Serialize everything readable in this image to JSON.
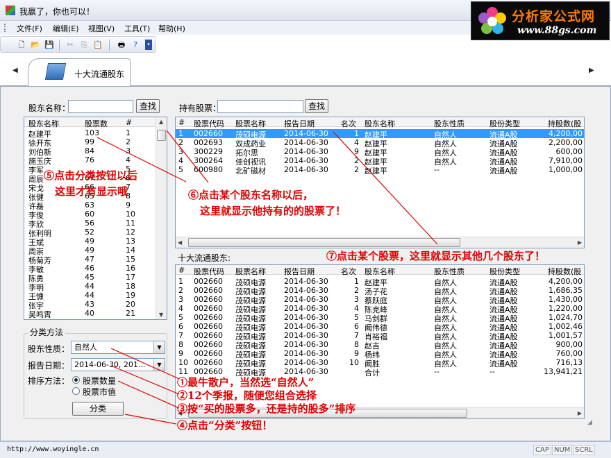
{
  "window": {
    "title": "我嬴了，你也可以！"
  },
  "logo": {
    "title": "分析家公式网",
    "url": "www.88gs.com"
  },
  "menu": [
    "文件(F)",
    "编辑(E)",
    "视图(V)",
    "工具(T)",
    "帮助(H)"
  ],
  "toolbar": {
    "icons": [
      "new-icon",
      "open-icon",
      "save-icon",
      "cut-icon",
      "copy-icon",
      "paste-icon",
      "print-icon",
      "help-icon"
    ]
  },
  "tab": {
    "label": "十大流通股东"
  },
  "left": {
    "name_label": "股东名称：",
    "search_btn": "查找",
    "columns": [
      "股东名称",
      "股票数",
      "#"
    ],
    "rows": [
      [
        "赵建平",
        "103",
        "1"
      ],
      [
        "徐开东",
        "99",
        "2"
      ],
      [
        "刘伯新",
        "84",
        "3"
      ],
      [
        "施玉庆",
        "76",
        "4"
      ],
      [
        "李军",
        "",
        "5"
      ],
      [
        "周辰",
        "67",
        "6"
      ],
      [
        "宋戈",
        "66",
        "7"
      ],
      [
        "张健",
        "65",
        "8"
      ],
      [
        "许磊",
        "63",
        "9"
      ],
      [
        "李俊",
        "60",
        "10"
      ],
      [
        "李欣",
        "56",
        "11"
      ],
      [
        "张利明",
        "52",
        "12"
      ],
      [
        "王斌",
        "49",
        "13"
      ],
      [
        "周崇",
        "49",
        "14"
      ],
      [
        "杨菊芳",
        "47",
        "15"
      ],
      [
        "李敏",
        "46",
        "16"
      ],
      [
        "陈勇",
        "45",
        "17"
      ],
      [
        "李明",
        "44",
        "18"
      ],
      [
        "王慷",
        "44",
        "19"
      ],
      [
        "张宇",
        "43",
        "20"
      ],
      [
        "吴鸣霄",
        "40",
        "21"
      ]
    ]
  },
  "filter": {
    "title": "分类方法",
    "nature_label": "股东性质：",
    "nature_value": "自然人",
    "date_label": "报告日期：",
    "date_value": "2014-06-30, 201...",
    "sort_label": "排序方法：",
    "sort_options": [
      "股票数量",
      "股票市值"
    ],
    "classify_btn": "分类"
  },
  "holdings": {
    "label": "持有股票：",
    "search_btn": "查找",
    "columns": [
      "#",
      "股票代码",
      "股票名称",
      "报告日期",
      "名次",
      "股东名称",
      "股东性质",
      "股份类型",
      "持股数(股"
    ],
    "rows": [
      [
        "1",
        "002660",
        "茂硕电源",
        "2014-06-30",
        "1",
        "赵建平",
        "自然人",
        "流通A股",
        "4,200,00"
      ],
      [
        "2",
        "002693",
        "双成药业",
        "2014-06-30",
        "4",
        "赵建平",
        "自然人",
        "流通A股",
        "2,200,00"
      ],
      [
        "3",
        "300229",
        "拓尔思",
        "2014-06-30",
        "9",
        "赵建平",
        "自然人",
        "流通A股",
        "600,00"
      ],
      [
        "4",
        "300264",
        "佳创视讯",
        "2014-06-30",
        "2",
        "赵建平",
        "自然人",
        "流通A股",
        "7,910,00"
      ],
      [
        "5",
        "600980",
        "北矿磁材",
        "2014-06-30",
        "2",
        "赵建平",
        "--",
        "流通A股",
        "1,000,00"
      ]
    ]
  },
  "top10": {
    "label": "十大流通股东:",
    "columns": [
      "#",
      "股票代码",
      "股票名称",
      "报告日期",
      "名次",
      "股东名称",
      "股东性质",
      "股份类型",
      "持股数(股"
    ],
    "rows": [
      [
        "1",
        "002660",
        "茂硕电源",
        "2014-06-30",
        "1",
        "赵建平",
        "自然人",
        "流通A股",
        "4,200,00"
      ],
      [
        "2",
        "002660",
        "茂硕电源",
        "2014-06-30",
        "2",
        "汤子花",
        "自然人",
        "流通A股",
        "1,686,35"
      ],
      [
        "3",
        "002660",
        "茂硕电源",
        "2014-06-30",
        "3",
        "蔡跃庭",
        "自然人",
        "流通A股",
        "1,430,00"
      ],
      [
        "4",
        "002660",
        "茂硕电源",
        "2014-06-30",
        "4",
        "陈克峰",
        "自然人",
        "流通A股",
        "1,220,00"
      ],
      [
        "5",
        "002660",
        "茂硕电源",
        "2014-06-30",
        "5",
        "马剑群",
        "自然人",
        "流通A股",
        "1,024,70"
      ],
      [
        "6",
        "002660",
        "茂硕电源",
        "2014-06-30",
        "6",
        "阚伟德",
        "自然人",
        "流通A股",
        "1,002,46"
      ],
      [
        "7",
        "002660",
        "茂硕电源",
        "2014-06-30",
        "7",
        "肖裕福",
        "自然人",
        "流通A股",
        "1,001,57"
      ],
      [
        "8",
        "002660",
        "茂硕电源",
        "2014-06-30",
        "8",
        "赵吉",
        "自然人",
        "流通A股",
        "900,00"
      ],
      [
        "9",
        "002660",
        "茂硕电源",
        "2014-06-30",
        "9",
        "杨纬",
        "自然人",
        "流通A股",
        "760,00"
      ],
      [
        "10",
        "002660",
        "茂硕电源",
        "2014-06-30",
        "10",
        "阚胜",
        "自然人",
        "流通A股",
        "716,13"
      ],
      [
        "11",
        "002660",
        "茂硕电源",
        "2014-06-30",
        "",
        "合计",
        "--",
        "--",
        "13,941,21"
      ]
    ]
  },
  "annotations": {
    "a1": "①最牛散户，当然选“自然人”",
    "a2": "②12个季报，随便您组合选择",
    "a3": "③按“买的股票多，还是持的股多”排序",
    "a4": "④点击“分类”按钮！",
    "a5a": "⑤点击分类按钮以后",
    "a5b": "这里才有显示哦",
    "a6a": "⑥点击某个股东名称以后，",
    "a6b": "这里就显示他持有的的股票了！",
    "a7": "⑦点击某个股票，这里就显示其他几个股东了！"
  },
  "status": {
    "url": "http://www.woyingle.cn",
    "keys": [
      "CAP",
      "NUM",
      "SCRL"
    ]
  },
  "colors": {
    "selection": "#3399ff",
    "annotation": "#e00000"
  }
}
